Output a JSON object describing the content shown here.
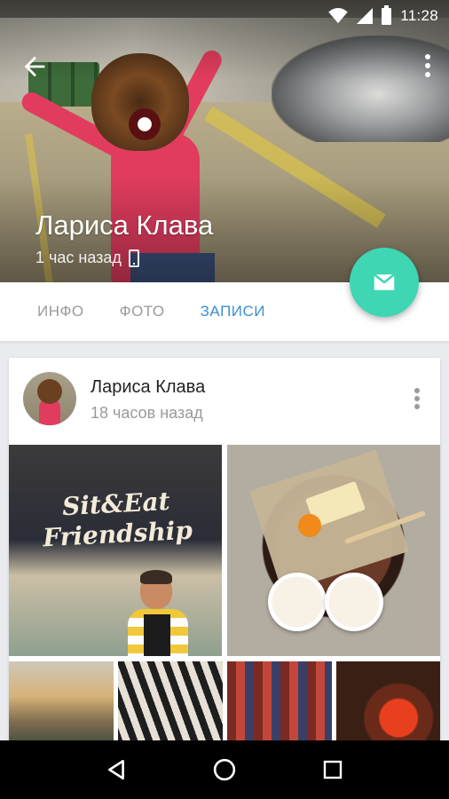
{
  "status_bar": {
    "time": "11:28"
  },
  "profile": {
    "name": "Лариса Клава",
    "last_seen": "1 час назад"
  },
  "tabs": [
    {
      "label": "ИНФО",
      "active": false
    },
    {
      "label": "ФОТО",
      "active": false
    },
    {
      "label": "ЗАПИСИ",
      "active": true
    }
  ],
  "post": {
    "author": "Лариса Клава",
    "time": "18 часов назад",
    "photo_sign_text": "Sit&Eat Friendship"
  },
  "colors": {
    "accent": "#3c8fd0",
    "fab": "#3fd6b4",
    "tab_inactive": "#9a9a9a"
  },
  "icons": {
    "back": "arrow-left-icon",
    "more": "more-vert-icon",
    "message": "mail-icon",
    "device": "mobile-phone-icon"
  }
}
